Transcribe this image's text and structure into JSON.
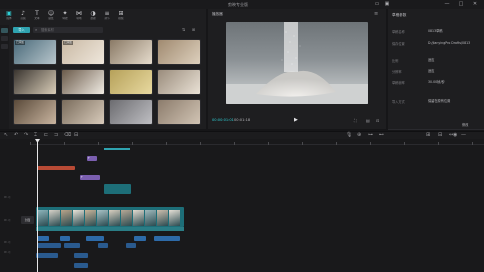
{
  "app": {
    "title": "剪映专业版"
  },
  "window_controls": [
    "▭",
    "▣",
    "—",
    "□",
    "✕"
  ],
  "media_toolbar": {
    "tools": [
      {
        "icon": "media-icon",
        "glyph": "▣",
        "label": "媒体"
      },
      {
        "icon": "audio-icon",
        "glyph": "♪",
        "label": "音频"
      },
      {
        "icon": "text-icon",
        "glyph": "T",
        "label": "文本"
      },
      {
        "icon": "sticker-icon",
        "glyph": "☺",
        "label": "贴纸"
      },
      {
        "icon": "effects-icon",
        "glyph": "✦",
        "label": "特效"
      },
      {
        "icon": "transition-icon",
        "glyph": "⋈",
        "label": "转场"
      },
      {
        "icon": "filter-icon",
        "glyph": "◑",
        "label": "滤镜"
      },
      {
        "icon": "adjust-icon",
        "glyph": "≡",
        "label": "调节"
      },
      {
        "icon": "template-icon",
        "glyph": "⊞",
        "label": "模板"
      }
    ]
  },
  "media_panel": {
    "import_label": "导入",
    "search_placeholder": "搜索素材",
    "thumbnails": [
      {
        "label": "已添加",
        "c1": "#4a6a7a",
        "c2": "#b8c6cc"
      },
      {
        "label": "已添加",
        "c1": "#c9b9a4",
        "c2": "#efe7dc"
      },
      {
        "label": "",
        "c1": "#8a7a66",
        "c2": "#e6dccd"
      },
      {
        "label": "",
        "c1": "#a08a70",
        "c2": "#ddd0bd"
      },
      {
        "label": "",
        "c1": "#3a3530",
        "c2": "#d9cdb8"
      },
      {
        "label": "",
        "c1": "#6a5a4a",
        "c2": "#f1ece4"
      },
      {
        "label": "",
        "c1": "#b6a15a",
        "c2": "#e8d9a0"
      },
      {
        "label": "",
        "c1": "#9a8c7c",
        "c2": "#eae2d6"
      },
      {
        "label": "",
        "c1": "#5a4a3a",
        "c2": "#c9b5a0"
      },
      {
        "label": "",
        "c1": "#7a6c5c",
        "c2": "#d8cbbb"
      },
      {
        "label": "",
        "c1": "#6c6c70",
        "c2": "#bfbfc3"
      },
      {
        "label": "",
        "c1": "#8c7c6c",
        "c2": "#d1c4b4"
      }
    ]
  },
  "player": {
    "title": "播放器",
    "current_time": "00:00:01:01",
    "total_time": "00:01:18",
    "controls_right": [
      "⛶",
      "▤",
      "⊡"
    ]
  },
  "properties": {
    "title": "草稿参数",
    "rows": [
      {
        "label": "草稿名称",
        "value": "0813草稿"
      },
      {
        "label": "保存位置",
        "value": "D:/JianyingPro Drafts/0813"
      },
      {
        "label": "比例",
        "value": "适应"
      },
      {
        "label": "分辨率",
        "value": "适应"
      },
      {
        "label": "草稿帧率",
        "value": "30.00帧/秒"
      },
      {
        "label": "导入方式",
        "value": "保留在原有位置"
      }
    ],
    "modify_label": "修改"
  },
  "timeline_toolbar": {
    "left_tools": [
      "↖",
      "↶",
      "↷",
      "⌶",
      "⊏",
      "⊐",
      "⌫",
      "⊟"
    ],
    "right_tools": [
      "🎙",
      "⊕",
      "⊶",
      "⊷",
      "⊞",
      "⊟",
      "↔",
      "◉",
      "—"
    ]
  },
  "timeline": {
    "ruler_ticks": 14,
    "cover_label": "封面",
    "clips": [
      {
        "track": "audio",
        "text": ""
      },
      {
        "track": "text",
        "text": "T"
      },
      {
        "track": "text",
        "text": "T"
      },
      {
        "track": "sticker",
        "text": ""
      },
      {
        "track": "main",
        "text": ""
      },
      {
        "track": "subtitle",
        "text": ""
      }
    ]
  },
  "colors": {
    "accent": "#2fd0d6",
    "video_clip": "#1d6e78",
    "text_clip": "#7b5fb0",
    "audio_clip": "#b84a35",
    "subtitle_clip": "#2d6aa8"
  }
}
